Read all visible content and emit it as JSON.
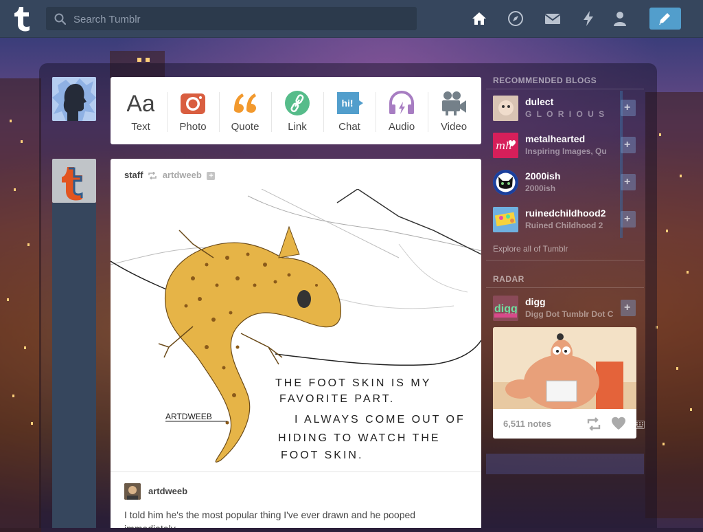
{
  "header": {
    "search_placeholder": "Search Tumblr",
    "nav": [
      "home-icon",
      "explore-icon",
      "messages-icon",
      "activity-icon",
      "account-icon"
    ],
    "accent": "#529ecc",
    "bar_color": "#36465d"
  },
  "post_types": [
    {
      "label": "Text",
      "icon": "text-icon",
      "color": "#444444"
    },
    {
      "label": "Photo",
      "icon": "camera-icon",
      "color": "#d95e40"
    },
    {
      "label": "Quote",
      "icon": "quote-icon",
      "color": "#f2992e"
    },
    {
      "label": "Link",
      "icon": "link-icon",
      "color": "#56bc8a"
    },
    {
      "label": "Chat",
      "icon": "chat-icon",
      "color": "#529ecc"
    },
    {
      "label": "Audio",
      "icon": "headphones-icon",
      "color": "#a77dc2"
    },
    {
      "label": "Video",
      "icon": "video-camera-icon",
      "color": "#748089"
    }
  ],
  "post": {
    "author": "staff",
    "reblogged_from": "artdweeb",
    "image_caption_lines": [
      "THE FOOT SKIN IS MY",
      "FAVORITE PART.",
      "I ALWAYS COME OUT OF",
      "HIDING TO WATCH THE",
      "FOOT SKIN."
    ],
    "image_signature": "ARTDWEEB",
    "reblog_user": "artdweeb",
    "text": "I told him he's the most popular thing I've ever drawn and he pooped immediately."
  },
  "sidebar": {
    "recommended_title": "RECOMMENDED BLOGS",
    "blogs": [
      {
        "name": "dulect",
        "desc": "G L O R I O U S"
      },
      {
        "name": "metalhearted",
        "desc": "Inspiring Images, Qu"
      },
      {
        "name": "2000ish",
        "desc": "2000ish"
      },
      {
        "name": "ruinedchildhood2",
        "desc": "Ruined Childhood 2"
      }
    ],
    "explore": "Explore all of Tumblr",
    "radar_title": "RADAR",
    "radar_blog": {
      "name": "digg",
      "desc": "Digg Dot Tumblr Dot C"
    },
    "radar_notes": "6,511 notes"
  }
}
